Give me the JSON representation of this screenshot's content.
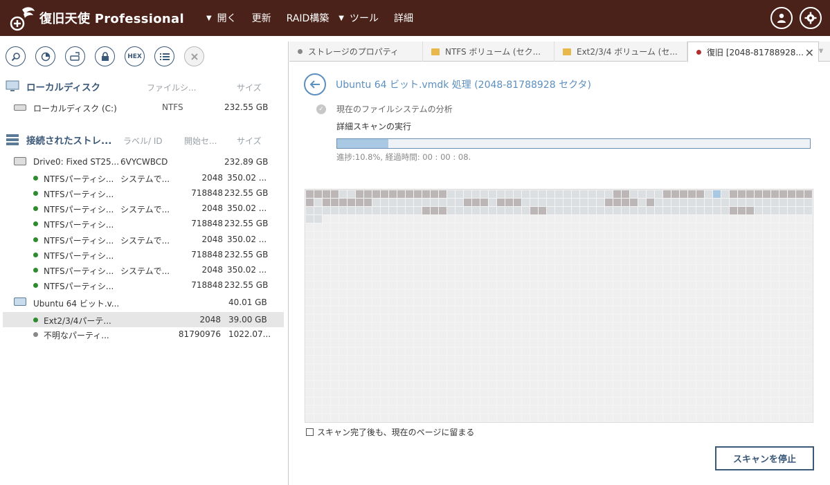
{
  "app": {
    "title": "復旧天使 Professional"
  },
  "menu": [
    {
      "label": "開く",
      "caret": true
    },
    {
      "label": "更新",
      "caret": false
    },
    {
      "label": "RAID構築",
      "caret": false
    },
    {
      "label": "ツール",
      "caret": true
    },
    {
      "label": "詳細",
      "caret": false
    }
  ],
  "top_icons": [
    "user-icon",
    "gear-icon"
  ],
  "left_toolbar": [
    "search-icon",
    "pie-chart-icon",
    "drive-export-icon",
    "lock-icon",
    "hex-icon",
    "list-icon",
    "close-icon"
  ],
  "left_toolbar_hex_label": "HEX",
  "local": {
    "title": "ローカルディスク",
    "col_fs": "ファイルシ...",
    "col_size": "サイズ",
    "items": [
      {
        "name": "ローカルディスク (C:)",
        "fs": "NTFS",
        "size": "232.55 GB"
      }
    ]
  },
  "storage": {
    "title": "接続されたストレ...",
    "col_label": "ラベル/ ID",
    "col_start": "開始セ...",
    "col_size": "サイズ",
    "drive0": {
      "name": "Drive0: Fixed ST25...",
      "id": "6VYCWBCD",
      "size": "232.89 GB"
    },
    "partitions": [
      {
        "name": "NTFSパーティシ...",
        "label": "システムで...",
        "start": "2048",
        "size": "350.02 ..."
      },
      {
        "name": "NTFSパーティシ...",
        "label": "",
        "start": "718848",
        "size": "232.55 GB"
      },
      {
        "name": "NTFSパーティシ...",
        "label": "システムで...",
        "start": "2048",
        "size": "350.02 ..."
      },
      {
        "name": "NTFSパーティシ...",
        "label": "",
        "start": "718848",
        "size": "232.55 GB"
      },
      {
        "name": "NTFSパーティシ...",
        "label": "システムで...",
        "start": "2048",
        "size": "350.02 ..."
      },
      {
        "name": "NTFSパーティシ...",
        "label": "",
        "start": "718848",
        "size": "232.55 GB"
      },
      {
        "name": "NTFSパーティシ...",
        "label": "システムで...",
        "start": "2048",
        "size": "350.02 ..."
      },
      {
        "name": "NTFSパーティシ...",
        "label": "",
        "start": "718848",
        "size": "232.55 GB"
      }
    ],
    "vm": {
      "name": "Ubuntu 64 ビット.v...",
      "size": "40.01 GB"
    },
    "vm_parts": [
      {
        "name": "Ext2/3/4パーテ...",
        "start": "2048",
        "size": "39.00 GB"
      },
      {
        "name": "不明なパーティ...",
        "start": "81790976",
        "size": "1022.07..."
      }
    ]
  },
  "tabs": [
    {
      "label": "ストレージのプロパティ"
    },
    {
      "label": "NTFS ボリューム (セク..."
    },
    {
      "label": "Ext2/3/4 ボリューム (セ..."
    },
    {
      "label": "復旧 [2048-81788928..."
    }
  ],
  "scan": {
    "title": "Ubuntu 64 ビット.vmdk 処理 (2048-81788928 セクタ)",
    "step1": "現在のファイルシステムの分析",
    "step2": "詳細スキャンの実行",
    "progress": 0.108,
    "progress_text": "進捗:10.8%, 経過時間: 00 : 00 : 08.",
    "stay_label": "スキャン完了後も、現在のページに留まる",
    "stop_label": "スキャンを停止"
  },
  "colors": {
    "topbar": "#4b2219",
    "accent": "#3a5878",
    "progress": "#a9c8e4",
    "ok_dot": "#2e8b2e"
  }
}
